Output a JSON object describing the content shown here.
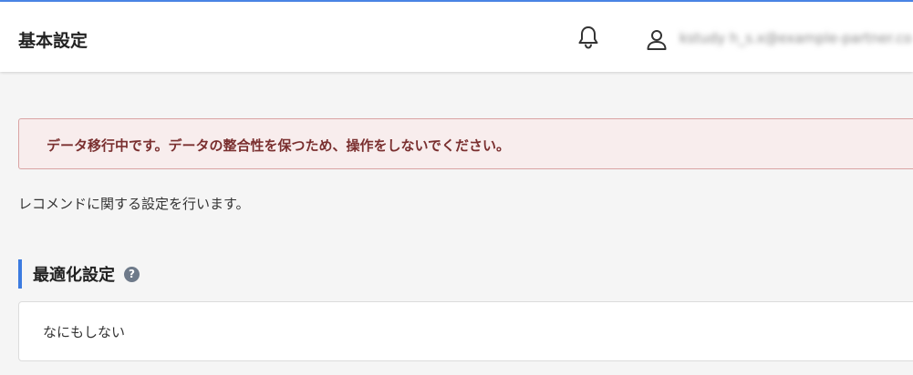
{
  "header": {
    "title": "基本設定",
    "bell_icon": "bell-icon",
    "user_icon": "user-icon",
    "user_name": "kstudy h_s.x@example-partner.com"
  },
  "alert": {
    "message": "データ移行中です。データの整合性を保つため、操作をしないでください。",
    "color": "#7a2f2f",
    "background": "#f8eded"
  },
  "description": "レコメンドに関する設定を行います。",
  "optimization": {
    "title": "最適化設定",
    "help_icon": "question-circle-icon",
    "accent_color": "#3c7be0",
    "selected_option": "なにもしない"
  }
}
